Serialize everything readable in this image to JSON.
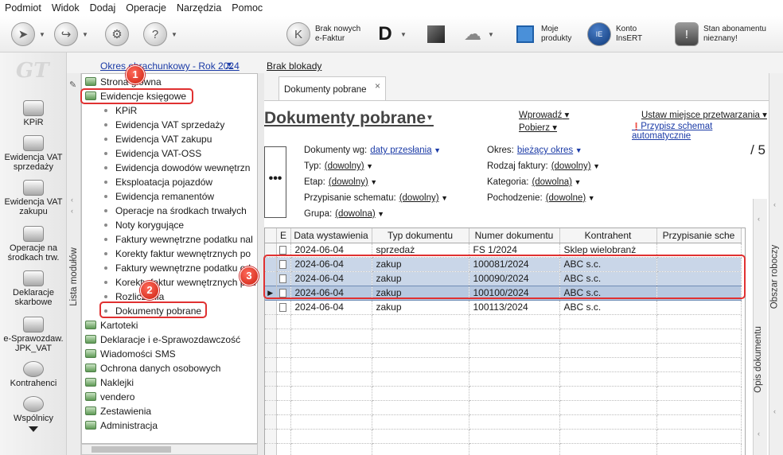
{
  "menu": [
    "Podmiot",
    "Widok",
    "Dodaj",
    "Operacje",
    "Narzędzia",
    "Pomoc"
  ],
  "toolbar": {
    "efaktur": "Brak nowych\ne-Faktur",
    "d_label": "D",
    "moje_produkty": "Moje\nprodukty",
    "konto": "Konto\nInsERT",
    "stan": "Stan abonamentu\nnieznany!"
  },
  "left_nav": {
    "logo": "GT",
    "items": [
      {
        "label": "KPiR"
      },
      {
        "label": "Ewidencja VAT\nsprzedaży"
      },
      {
        "label": "Ewidencja VAT\nzakupu"
      },
      {
        "label": "Operacje na\nśrodkach trw."
      },
      {
        "label": "Deklaracje\nskarbowe"
      },
      {
        "label": "e-Sprawozdaw.\nJPK_VAT"
      },
      {
        "label": "Kontrahenci"
      },
      {
        "label": "Wspólnicy"
      }
    ]
  },
  "topstrip": {
    "okres": "Okres obrachunkowy - Rok 2024",
    "brak_blokady": "Brak blokady"
  },
  "module_sidebar": "Lista modułów",
  "tree": {
    "top_items_1": [
      "Strona główna",
      "Ewidencje księgowe"
    ],
    "children": [
      "KPiR",
      "Ewidencja VAT sprzedaży",
      "Ewidencja VAT zakupu",
      "Ewidencja VAT-OSS",
      "Ewidencja dowodów wewnętrzn",
      "Eksploatacja pojazdów",
      "Ewidencja remanentów",
      "Operacje na środkach trwałych",
      "Noty korygujące",
      "Faktury wewnętrzne podatku nal",
      "Korekty faktur wewnętrznych po",
      "Faktury wewnętrzne podatku od",
      "Korekty faktur wewnętrznych pod",
      "Rozliczenia",
      "Dokumenty pobrane"
    ],
    "top_items_2": [
      "Kartoteki",
      "Deklaracje i e-Sprawozdawczość",
      "Wiadomości SMS",
      "Ochrona danych osobowych",
      "Naklejki",
      "vendero",
      "Zestawienia",
      "Administracja"
    ]
  },
  "badges": [
    "1",
    "2",
    "3"
  ],
  "tab": {
    "label": "Dokumenty pobrane",
    "close": "×"
  },
  "main": {
    "title": "Dokumenty pobrane",
    "wprowadz": "Wprowadź",
    "pobierz": "Pobierz",
    "ustaw": "Ustaw miejsce przetwarzania",
    "przypisz": "Przypisz schemat automatycznie",
    "count": "/ 5",
    "dots": "•••",
    "filters": {
      "dokumenty_wg": {
        "label": "Dokumenty wg:",
        "value": "daty przesłania"
      },
      "typ": {
        "label": "Typ:",
        "value": "(dowolny)"
      },
      "etap": {
        "label": "Etap:",
        "value": "(dowolny)"
      },
      "przypisanie": {
        "label": "Przypisanie schematu:",
        "value": "(dowolny)"
      },
      "grupa": {
        "label": "Grupa:",
        "value": "(dowolna)"
      },
      "okres": {
        "label": "Okres:",
        "value": "bieżący okres"
      },
      "rodzaj": {
        "label": "Rodzaj faktury:",
        "value": "(dowolny)"
      },
      "kategoria": {
        "label": "Kategoria:",
        "value": "(dowolna)"
      },
      "pochodzenie": {
        "label": "Pochodzenie:",
        "value": "(dowolne)"
      }
    }
  },
  "grid": {
    "columns": [
      "E",
      "Data wystawienia",
      "Typ dokumentu",
      "Numer dokumentu",
      "Kontrahent",
      "Przypisanie sche"
    ],
    "rows": [
      {
        "data": "2024-06-04",
        "typ": "sprzedaż",
        "numer": "FS 1/2024",
        "kontrahent": "Sklep wielobranż",
        "przypisanie": ""
      },
      {
        "data": "2024-06-04",
        "typ": "zakup",
        "numer": "100081/2024",
        "kontrahent": "ABC s.c.",
        "przypisanie": ""
      },
      {
        "data": "2024-06-04",
        "typ": "zakup",
        "numer": "100090/2024",
        "kontrahent": "ABC s.c.",
        "przypisanie": ""
      },
      {
        "data": "2024-06-04",
        "typ": "zakup",
        "numer": "100100/2024",
        "kontrahent": "ABC s.c.",
        "przypisanie": ""
      },
      {
        "data": "2024-06-04",
        "typ": "zakup",
        "numer": "100113/2024",
        "kontrahent": "ABC s.c.",
        "przypisanie": ""
      }
    ]
  },
  "right_panels": {
    "opis": "Opis dokumentu",
    "obszar": "Obszar roboczy"
  }
}
